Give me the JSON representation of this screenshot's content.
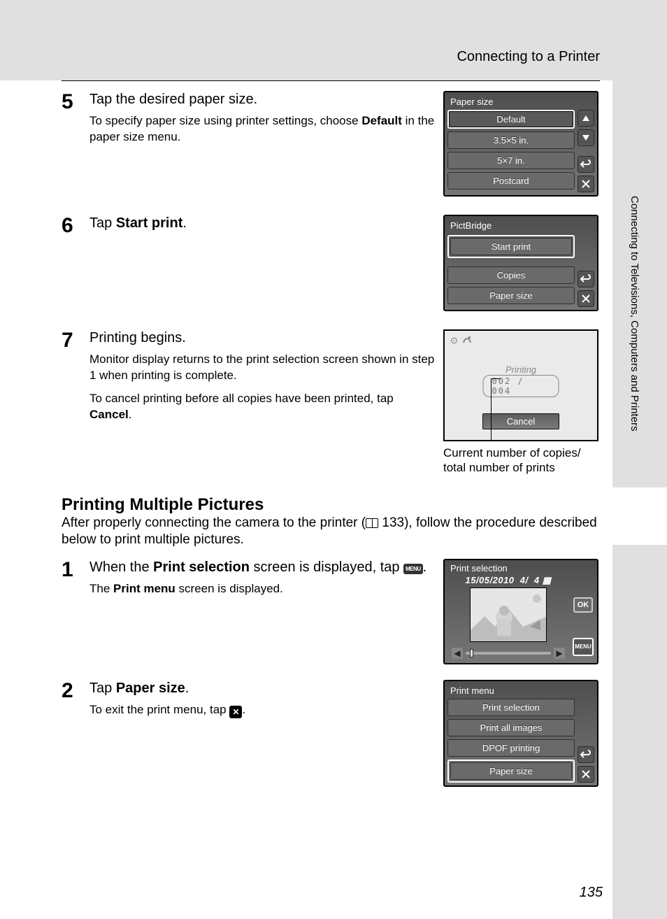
{
  "header": {
    "section": "Connecting to a Printer"
  },
  "side_tab": "Connecting to Televisions, Computers and Printers",
  "page_number": "135",
  "step5": {
    "num": "5",
    "title": "Tap the desired paper size.",
    "text_a": "To specify paper size using printer settings, choose ",
    "text_bold": "Default",
    "text_b": " in the paper size menu.",
    "screen_title": "Paper size",
    "options": [
      "Default",
      "3.5×5 in.",
      "5×7 in.",
      "Postcard"
    ]
  },
  "step6": {
    "num": "6",
    "title_a": "Tap ",
    "title_bold": "Start print",
    "title_b": ".",
    "screen_title": "PictBridge",
    "options": [
      "Start print",
      "Copies",
      "Paper size"
    ]
  },
  "step7": {
    "num": "7",
    "title": "Printing begins.",
    "text1": "Monitor display returns to the print selection screen shown in step 1 when printing is complete.",
    "text2_a": "To cancel printing before all copies have been printed, tap ",
    "text2_bold": "Cancel",
    "text2_b": ".",
    "caption": "Current number of copies/ total number of prints",
    "screen": {
      "status": "Printing",
      "counter": "002 / 004",
      "cancel": "Cancel"
    }
  },
  "section": {
    "title": "Printing Multiple Pictures",
    "intro_a": "After properly connecting the camera to the printer (",
    "intro_ref": " 133",
    "intro_b": "), follow the procedure described below to print multiple pictures."
  },
  "m_step1": {
    "num": "1",
    "title_a": "When the ",
    "title_bold": "Print selection",
    "title_b": " screen is displayed, tap ",
    "title_c": ".",
    "text_a": "The ",
    "text_bold": "Print menu",
    "text_b": " screen is displayed.",
    "screen": {
      "title": "Print selection",
      "date": "15/05/2010",
      "idx": "4/",
      "total": "4",
      "ok": "OK",
      "menu": "MENU"
    }
  },
  "m_step2": {
    "num": "2",
    "title_a": "Tap ",
    "title_bold": "Paper size",
    "title_b": ".",
    "text_a": "To exit the print menu, tap ",
    "text_b": ".",
    "screen": {
      "title": "Print menu",
      "options": [
        "Print selection",
        "Print all images",
        "DPOF printing",
        "Paper size"
      ]
    }
  }
}
